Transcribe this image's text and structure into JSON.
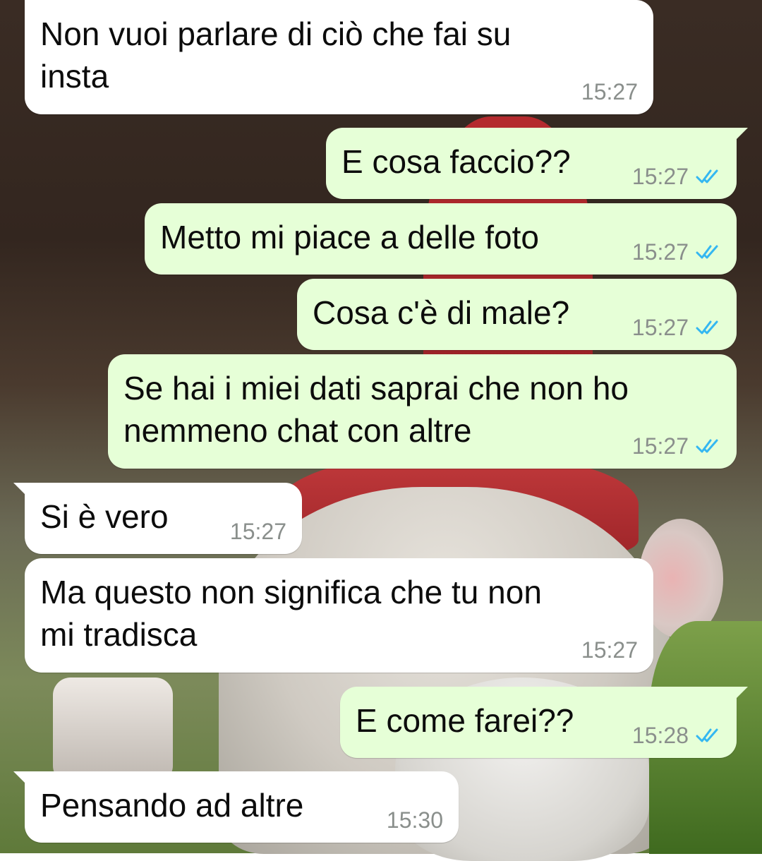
{
  "messages": [
    {
      "direction": "in",
      "text": "Non vuoi parlare di ciò che fai su\ninsta",
      "time": "15:27"
    },
    {
      "direction": "out",
      "text": "E cosa faccio??",
      "time": "15:27",
      "status": "read"
    },
    {
      "direction": "out",
      "text": "Metto mi piace a delle foto",
      "time": "15:27",
      "status": "read"
    },
    {
      "direction": "out",
      "text": "Cosa c'è di male?",
      "time": "15:27",
      "status": "read"
    },
    {
      "direction": "out",
      "text": "Se hai i miei dati saprai che non ho\nnemmeno chat con altre",
      "time": "15:27",
      "status": "read"
    },
    {
      "direction": "in",
      "text": "Si è vero",
      "time": "15:27"
    },
    {
      "direction": "in",
      "text": "Ma questo non significa che tu non\nmi tradisca",
      "time": "15:27"
    },
    {
      "direction": "out",
      "text": "E come farei??",
      "time": "15:28",
      "status": "read"
    },
    {
      "direction": "in",
      "text": "Pensando ad altre",
      "time": "15:30"
    }
  ],
  "colors": {
    "incoming_bubble": "#ffffff",
    "outgoing_bubble": "#e6ffd7",
    "read_tick": "#34b7f1",
    "timestamp": "#8a8f8c"
  },
  "icons": {
    "read_status": "double-check-icon"
  }
}
